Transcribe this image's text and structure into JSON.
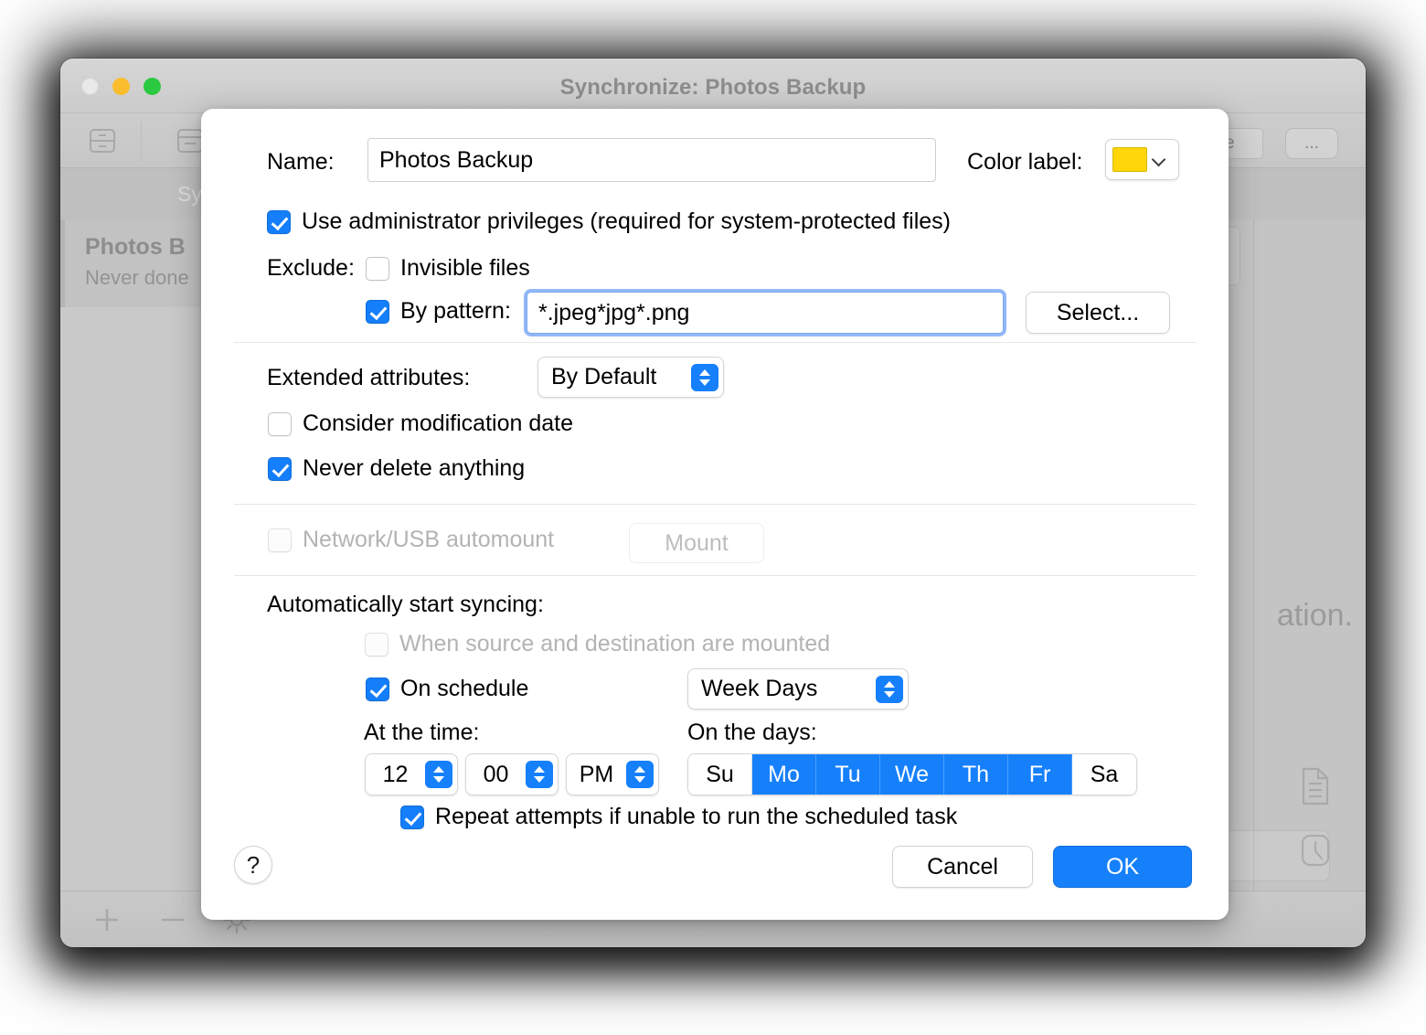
{
  "window": {
    "title": "Synchronize: Photos Backup",
    "traffic_lights": [
      "close",
      "minimize",
      "zoom"
    ],
    "toolbar": {
      "sync_button_label": "...onize",
      "more_button_label": "...",
      "icons": [
        "drawer-icon",
        "archive-icon"
      ]
    },
    "section_header": "Sy",
    "sidebar": {
      "rows": [
        {
          "title": "Photos B",
          "subtitle": "Never done"
        }
      ]
    },
    "content": {
      "fragment_text": "ation."
    },
    "bottom_bar": {
      "icons": [
        "plus-icon",
        "minus-icon",
        "gear-icon"
      ]
    },
    "side_icons": [
      "document-icon",
      "clock-icon"
    ]
  },
  "dialog": {
    "name": {
      "label": "Name:",
      "value": "Photos Backup",
      "placeholder": "Name"
    },
    "color_label": {
      "label": "Color label:",
      "color": "#FFD60A"
    },
    "admin_privileges": {
      "label": "Use administrator privileges (required for system-protected files)",
      "checked": true
    },
    "exclude": {
      "label": "Exclude:",
      "invisible_files": {
        "label": "Invisible files",
        "checked": false
      },
      "by_pattern": {
        "label": "By pattern:",
        "checked": true,
        "value": "*.jpeg*jpg*.png",
        "placeholder": "pattern",
        "select_button": "Select..."
      }
    },
    "extended_attributes": {
      "label": "Extended attributes:",
      "value": "By Default"
    },
    "consider_modification_date": {
      "label": "Consider modification date",
      "checked": false
    },
    "never_delete_anything": {
      "label": "Never delete anything",
      "checked": true
    },
    "automount": {
      "label": "Network/USB automount",
      "checked": false,
      "disabled": true,
      "mount_button": "Mount"
    },
    "auto_start": {
      "heading": "Automatically start syncing:",
      "when_mounted": {
        "label": "When source and destination are mounted",
        "checked": false,
        "disabled": true
      },
      "on_schedule": {
        "label": "On schedule",
        "checked": true,
        "frequency": "Week Days"
      },
      "at_the_time": {
        "label": "At the time:",
        "hour": "12",
        "minute": "00",
        "meridiem": "PM"
      },
      "on_the_days": {
        "label": "On the days:",
        "days": [
          {
            "label": "Su",
            "selected": false
          },
          {
            "label": "Mo",
            "selected": true
          },
          {
            "label": "Tu",
            "selected": true
          },
          {
            "label": "We",
            "selected": true
          },
          {
            "label": "Th",
            "selected": true
          },
          {
            "label": "Fr",
            "selected": true
          },
          {
            "label": "Sa",
            "selected": false
          }
        ]
      },
      "repeat_attempts": {
        "label": "Repeat attempts if unable to run the scheduled task",
        "checked": true
      }
    },
    "footer": {
      "help_label": "?",
      "cancel_label": "Cancel",
      "ok_label": "OK"
    }
  }
}
